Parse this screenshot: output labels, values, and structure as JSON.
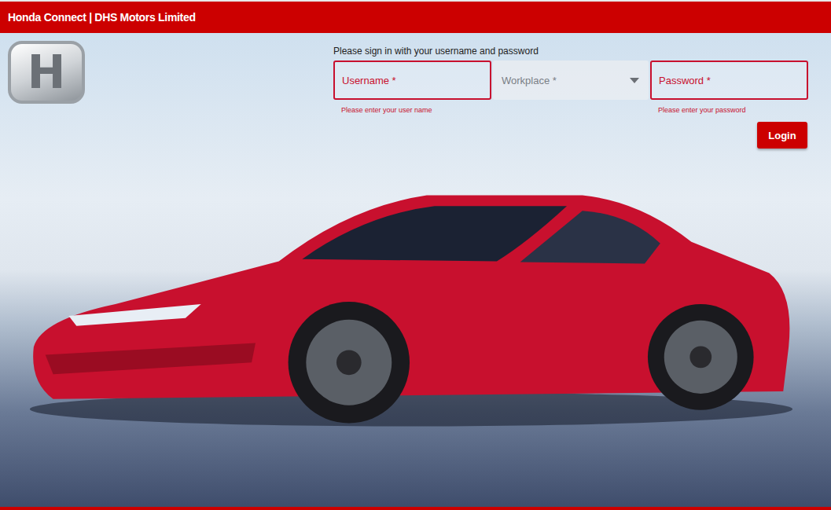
{
  "header": {
    "title": "Honda Connect | DHS Motors Limited"
  },
  "logo": {
    "mark": "H"
  },
  "form": {
    "prompt": "Please sign in with your username and password",
    "fields": [
      {
        "label": "Username *",
        "kind": "text",
        "invalid": true,
        "error": "Please enter your user name"
      },
      {
        "label": "Workplace *",
        "kind": "select",
        "invalid": false
      },
      {
        "label": "Password *",
        "kind": "password",
        "invalid": true,
        "error": "Please enter your password"
      }
    ],
    "button": "Login"
  }
}
